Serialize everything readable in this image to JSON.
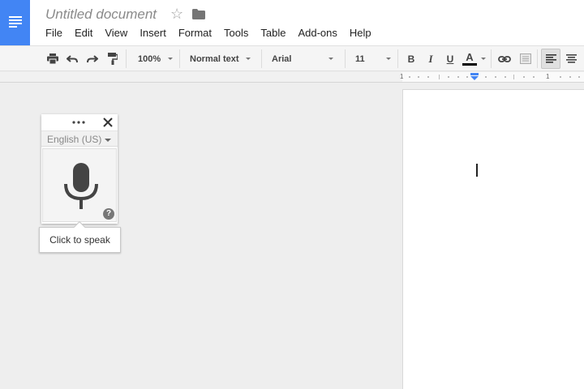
{
  "document": {
    "title": "Untitled document"
  },
  "menu": [
    "File",
    "Edit",
    "View",
    "Insert",
    "Format",
    "Tools",
    "Table",
    "Add-ons",
    "Help"
  ],
  "toolbar": {
    "zoom": "100%",
    "style": "Normal text",
    "font": "Arial",
    "font_size": "11",
    "bold_label": "B",
    "italic_label": "I",
    "underline_label": "U",
    "text_color_label": "A"
  },
  "ruler": {
    "left_number": "1",
    "right_number": "1"
  },
  "voice_typing": {
    "language": "English (US)",
    "help_label": "?",
    "tooltip": "Click to speak"
  },
  "colors": {
    "brand_blue": "#4285f4",
    "ruler_marker": "#4285f4",
    "text_color_bar": "#000000"
  },
  "icons": {
    "logo": "docs-logo-icon",
    "star": "star-icon",
    "folder": "folder-icon",
    "print": "print-icon",
    "undo": "undo-icon",
    "redo": "redo-icon",
    "paint_format": "paint-format-icon",
    "link": "link-icon",
    "comment": "comment-icon",
    "align_left": "align-left-icon",
    "align_center": "align-center-icon",
    "more": "more-horizontal-icon",
    "close": "close-icon",
    "mic": "microphone-icon",
    "help": "help-icon"
  }
}
